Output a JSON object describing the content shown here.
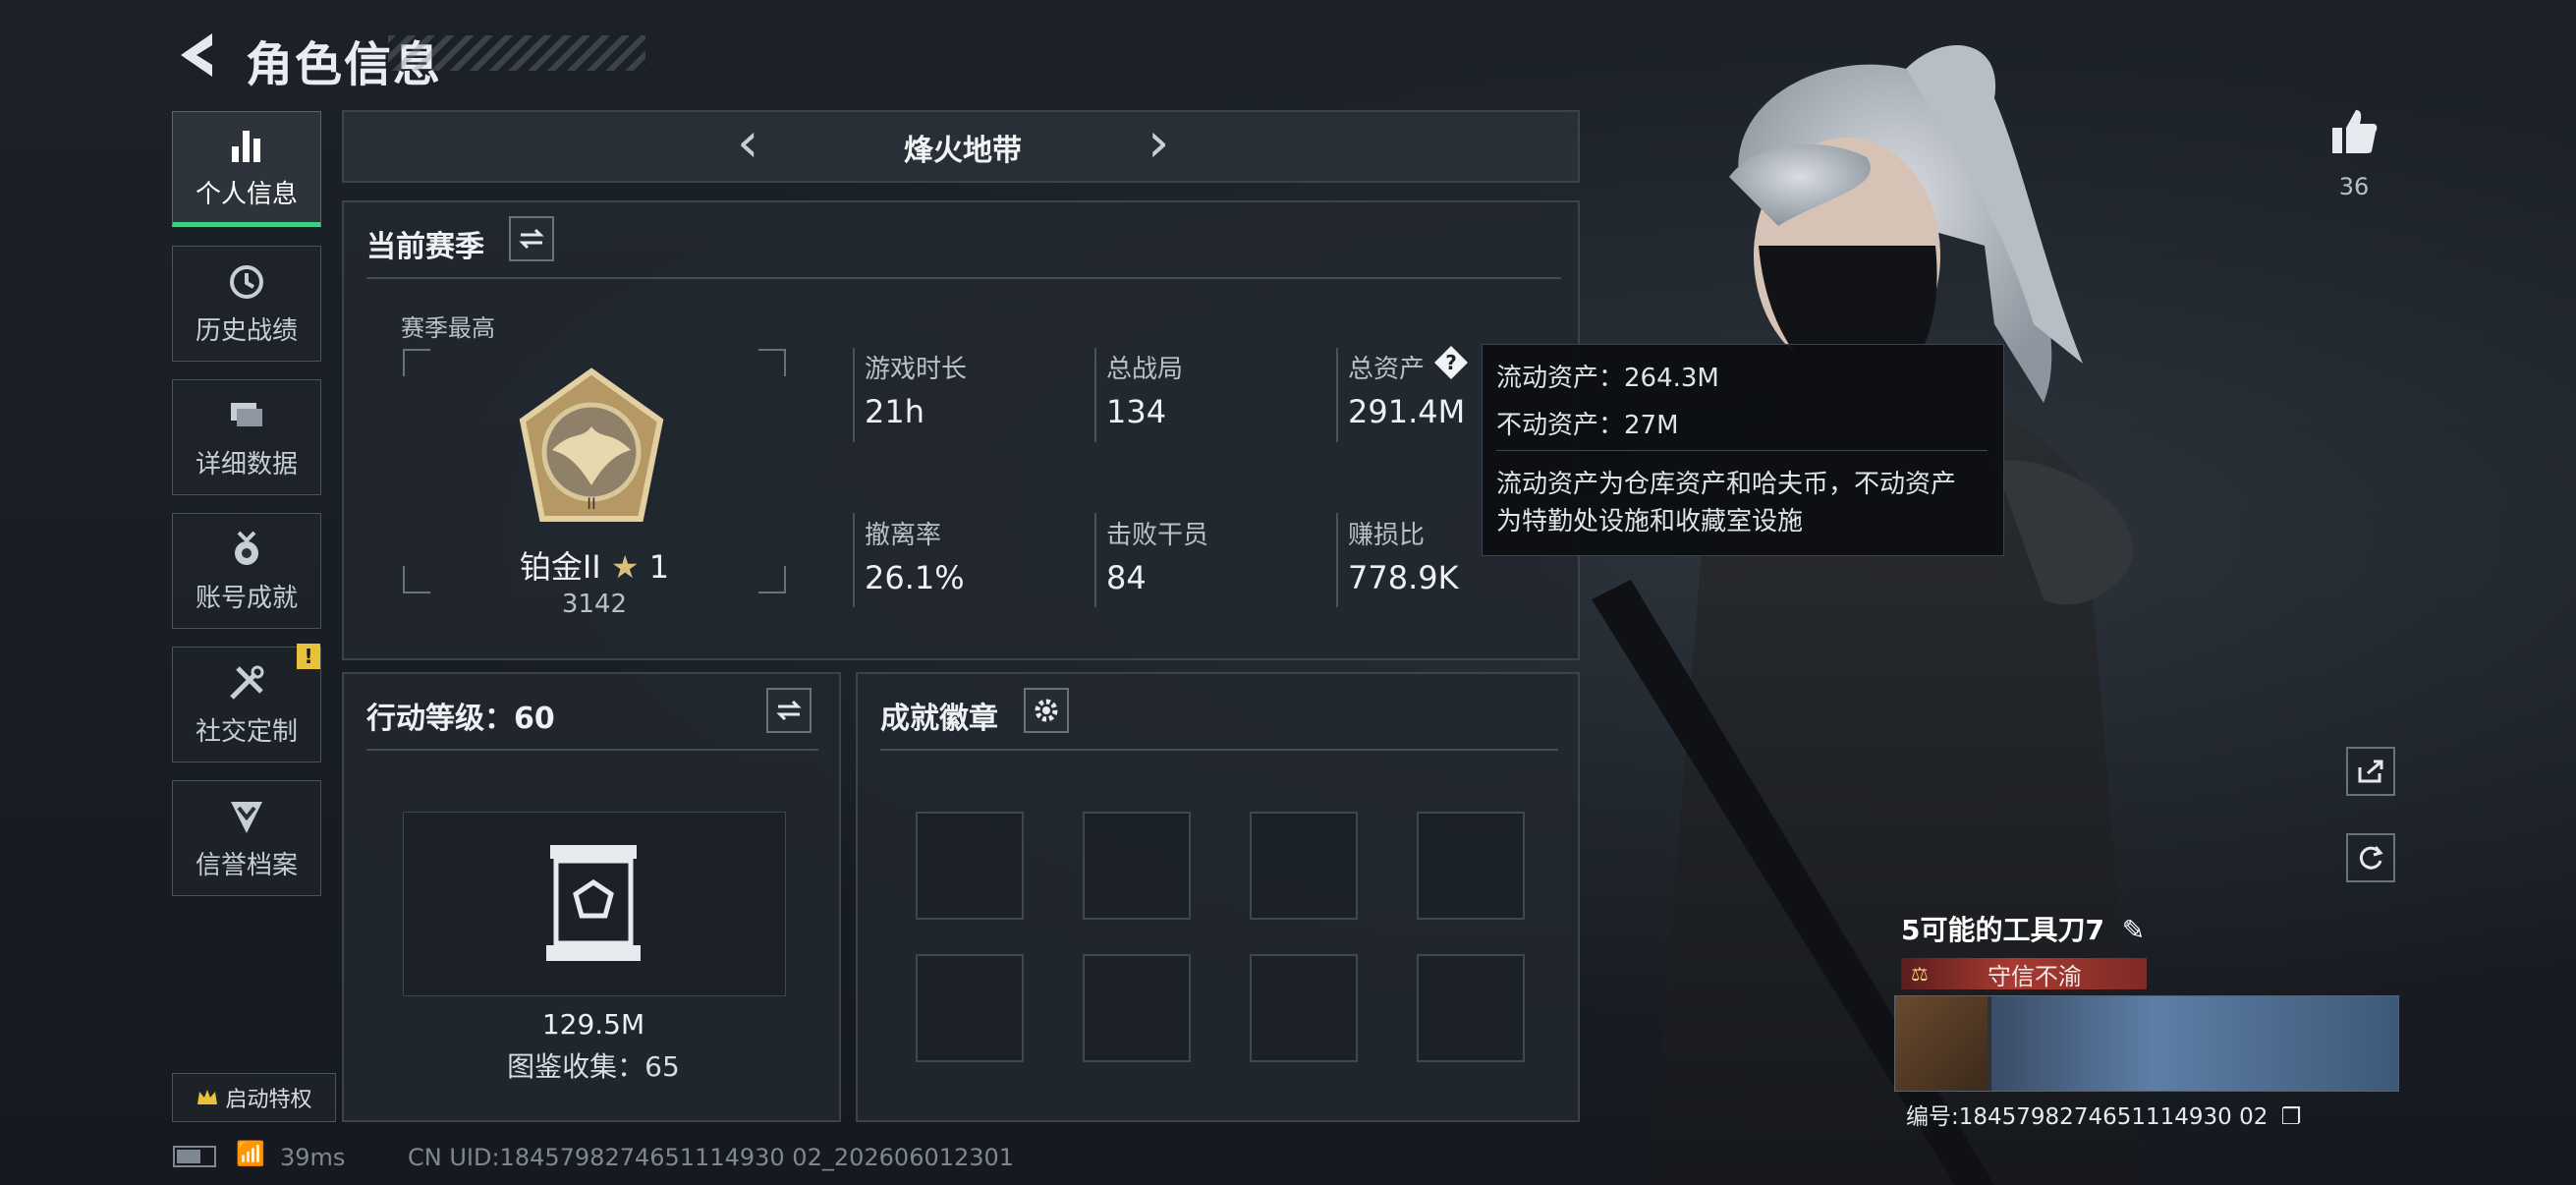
{
  "header": {
    "title": "角色信息"
  },
  "sidebar": {
    "items": [
      {
        "label": "个人信息",
        "icon": "bar-chart-icon",
        "active": true
      },
      {
        "label": "历史战绩",
        "icon": "clock-icon"
      },
      {
        "label": "详细数据",
        "icon": "stack-icon"
      },
      {
        "label": "账号成就",
        "icon": "medal-icon"
      },
      {
        "label": "社交定制",
        "icon": "tools-icon",
        "badge": "!"
      },
      {
        "label": "信誉档案",
        "icon": "shield-chevron-icon"
      }
    ],
    "privilege_label": "启动特权"
  },
  "mode": {
    "title": "烽火地带"
  },
  "season": {
    "title": "当前赛季",
    "best_label": "赛季最高",
    "rank_name": "铂金II",
    "rank_stars": "1",
    "rank_score": "3142",
    "stats": [
      {
        "label": "游戏时长",
        "value": "21h"
      },
      {
        "label": "总战局",
        "value": "134"
      },
      {
        "label": "总资产",
        "value": "291.4M"
      },
      {
        "label": "撤离率",
        "value": "26.1%"
      },
      {
        "label": "击败干员",
        "value": "84"
      },
      {
        "label": "赚损比",
        "value": "778.9K"
      }
    ]
  },
  "tooltip": {
    "liquid": "流动资产：264.3M",
    "fixed": "不动资产：27M",
    "desc_line1": "流动资产为仓库资产和哈夫币，不动资产",
    "desc_line2": "为特勤处设施和收藏室设施"
  },
  "action_level": {
    "title": "行动等级：60",
    "collection_value": "129.5M",
    "collection_label": "图鉴收集：65"
  },
  "achievements": {
    "title": "成就徽章",
    "slots": 8
  },
  "likes": {
    "count": "36"
  },
  "player": {
    "name": "5可能的工具刀7",
    "honor": "守信不渝",
    "id": "编号:1845798274651114930 02"
  },
  "status_bar": {
    "ping": "39ms",
    "uid": "CN UID:1845798274651114930 02_202606012301"
  },
  "colors": {
    "accent": "#3ccf8a",
    "alert": "#e8c23a",
    "honor": "#a83a32"
  }
}
